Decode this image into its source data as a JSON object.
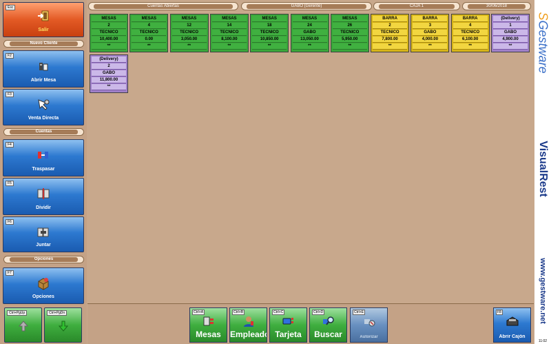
{
  "left_panel": {
    "salir": {
      "key": "Esc",
      "label": "Salir"
    },
    "section_new_client": "Nuevo Cliente",
    "abrir_mesa": {
      "key": "F2",
      "label": "Abrir Mesa"
    },
    "venta_directa": {
      "key": "F3",
      "label": "Venta Directa"
    },
    "section_cuentas": "Cuentas",
    "traspasar": {
      "key": "F4",
      "label": "Traspasar"
    },
    "dividir": {
      "key": "F5",
      "label": "Dividir"
    },
    "juntar": {
      "key": "F6",
      "label": "Juntar"
    },
    "section_opciones": "Opciones",
    "opciones": {
      "key": "F7",
      "label": "Opciones"
    },
    "page_up": {
      "key": "Ctrl+PgUp"
    },
    "page_down": {
      "key": "Ctrl+PgDn"
    }
  },
  "header": {
    "title": "Cuentas Abiertas",
    "user": "GABO (Gerente)",
    "register": "CAJA 1",
    "date": "30/06/2018"
  },
  "accounts": [
    {
      "area": "MESAS",
      "number": "2",
      "user": "TECNICO",
      "amount": "10,400.00",
      "mark": "**",
      "color": "green"
    },
    {
      "area": "MESAS",
      "number": "4",
      "user": "TECNICO",
      "amount": "0.00",
      "mark": "**",
      "color": "green"
    },
    {
      "area": "MESAS",
      "number": "12",
      "user": "TECNICO",
      "amount": "3,050.00",
      "mark": "**",
      "color": "green"
    },
    {
      "area": "MESAS",
      "number": "14",
      "user": "TECNICO",
      "amount": "8,100.00",
      "mark": "**",
      "color": "green"
    },
    {
      "area": "MESAS",
      "number": "18",
      "user": "TECNICO",
      "amount": "10,850.00",
      "mark": "**",
      "color": "green"
    },
    {
      "area": "MESAS",
      "number": "24",
      "user": "GABO",
      "amount": "13,050.00",
      "mark": "**",
      "color": "green"
    },
    {
      "area": "MESAS",
      "number": "26",
      "user": "TECNICO",
      "amount": "5,950.00",
      "mark": "**",
      "color": "green"
    },
    {
      "area": "BARRA",
      "number": "2",
      "user": "TECNICO",
      "amount": "7,800.00",
      "mark": "**",
      "color": "yellow"
    },
    {
      "area": "BARRA",
      "number": "3",
      "user": "GABO",
      "amount": "4,000.00",
      "mark": "**",
      "color": "yellow"
    },
    {
      "area": "BARRA",
      "number": "4",
      "user": "TECNICO",
      "amount": "6,100.00",
      "mark": "**",
      "color": "yellow"
    },
    {
      "area": "(Delivery)",
      "number": "1",
      "user": "GABO",
      "amount": "4,900.00",
      "mark": "**",
      "color": "purple"
    },
    {
      "area": "(Delivery)",
      "number": "2",
      "user": "GABO",
      "amount": "11,800.00",
      "mark": "**",
      "color": "purple"
    }
  ],
  "bottom_bar": {
    "mesas": {
      "key": "Ctrl+A",
      "label": "Mesas"
    },
    "empleado": {
      "key": "Ctrl+B",
      "label": "Empleado"
    },
    "tarjeta": {
      "key": "Ctrl+C",
      "label": "Tarjeta"
    },
    "buscar": {
      "key": "Ctrl+D",
      "label": "Buscar"
    },
    "autorizar": {
      "key": "Ctrl+E",
      "label": "Autorizar"
    },
    "abrir_cajon": {
      "key": "F8",
      "label": "Abrir Cajón"
    }
  },
  "branding": {
    "logo_text": "Gestware",
    "product": "VisualRest",
    "website": "www.gestware.net",
    "time": "11:02"
  }
}
